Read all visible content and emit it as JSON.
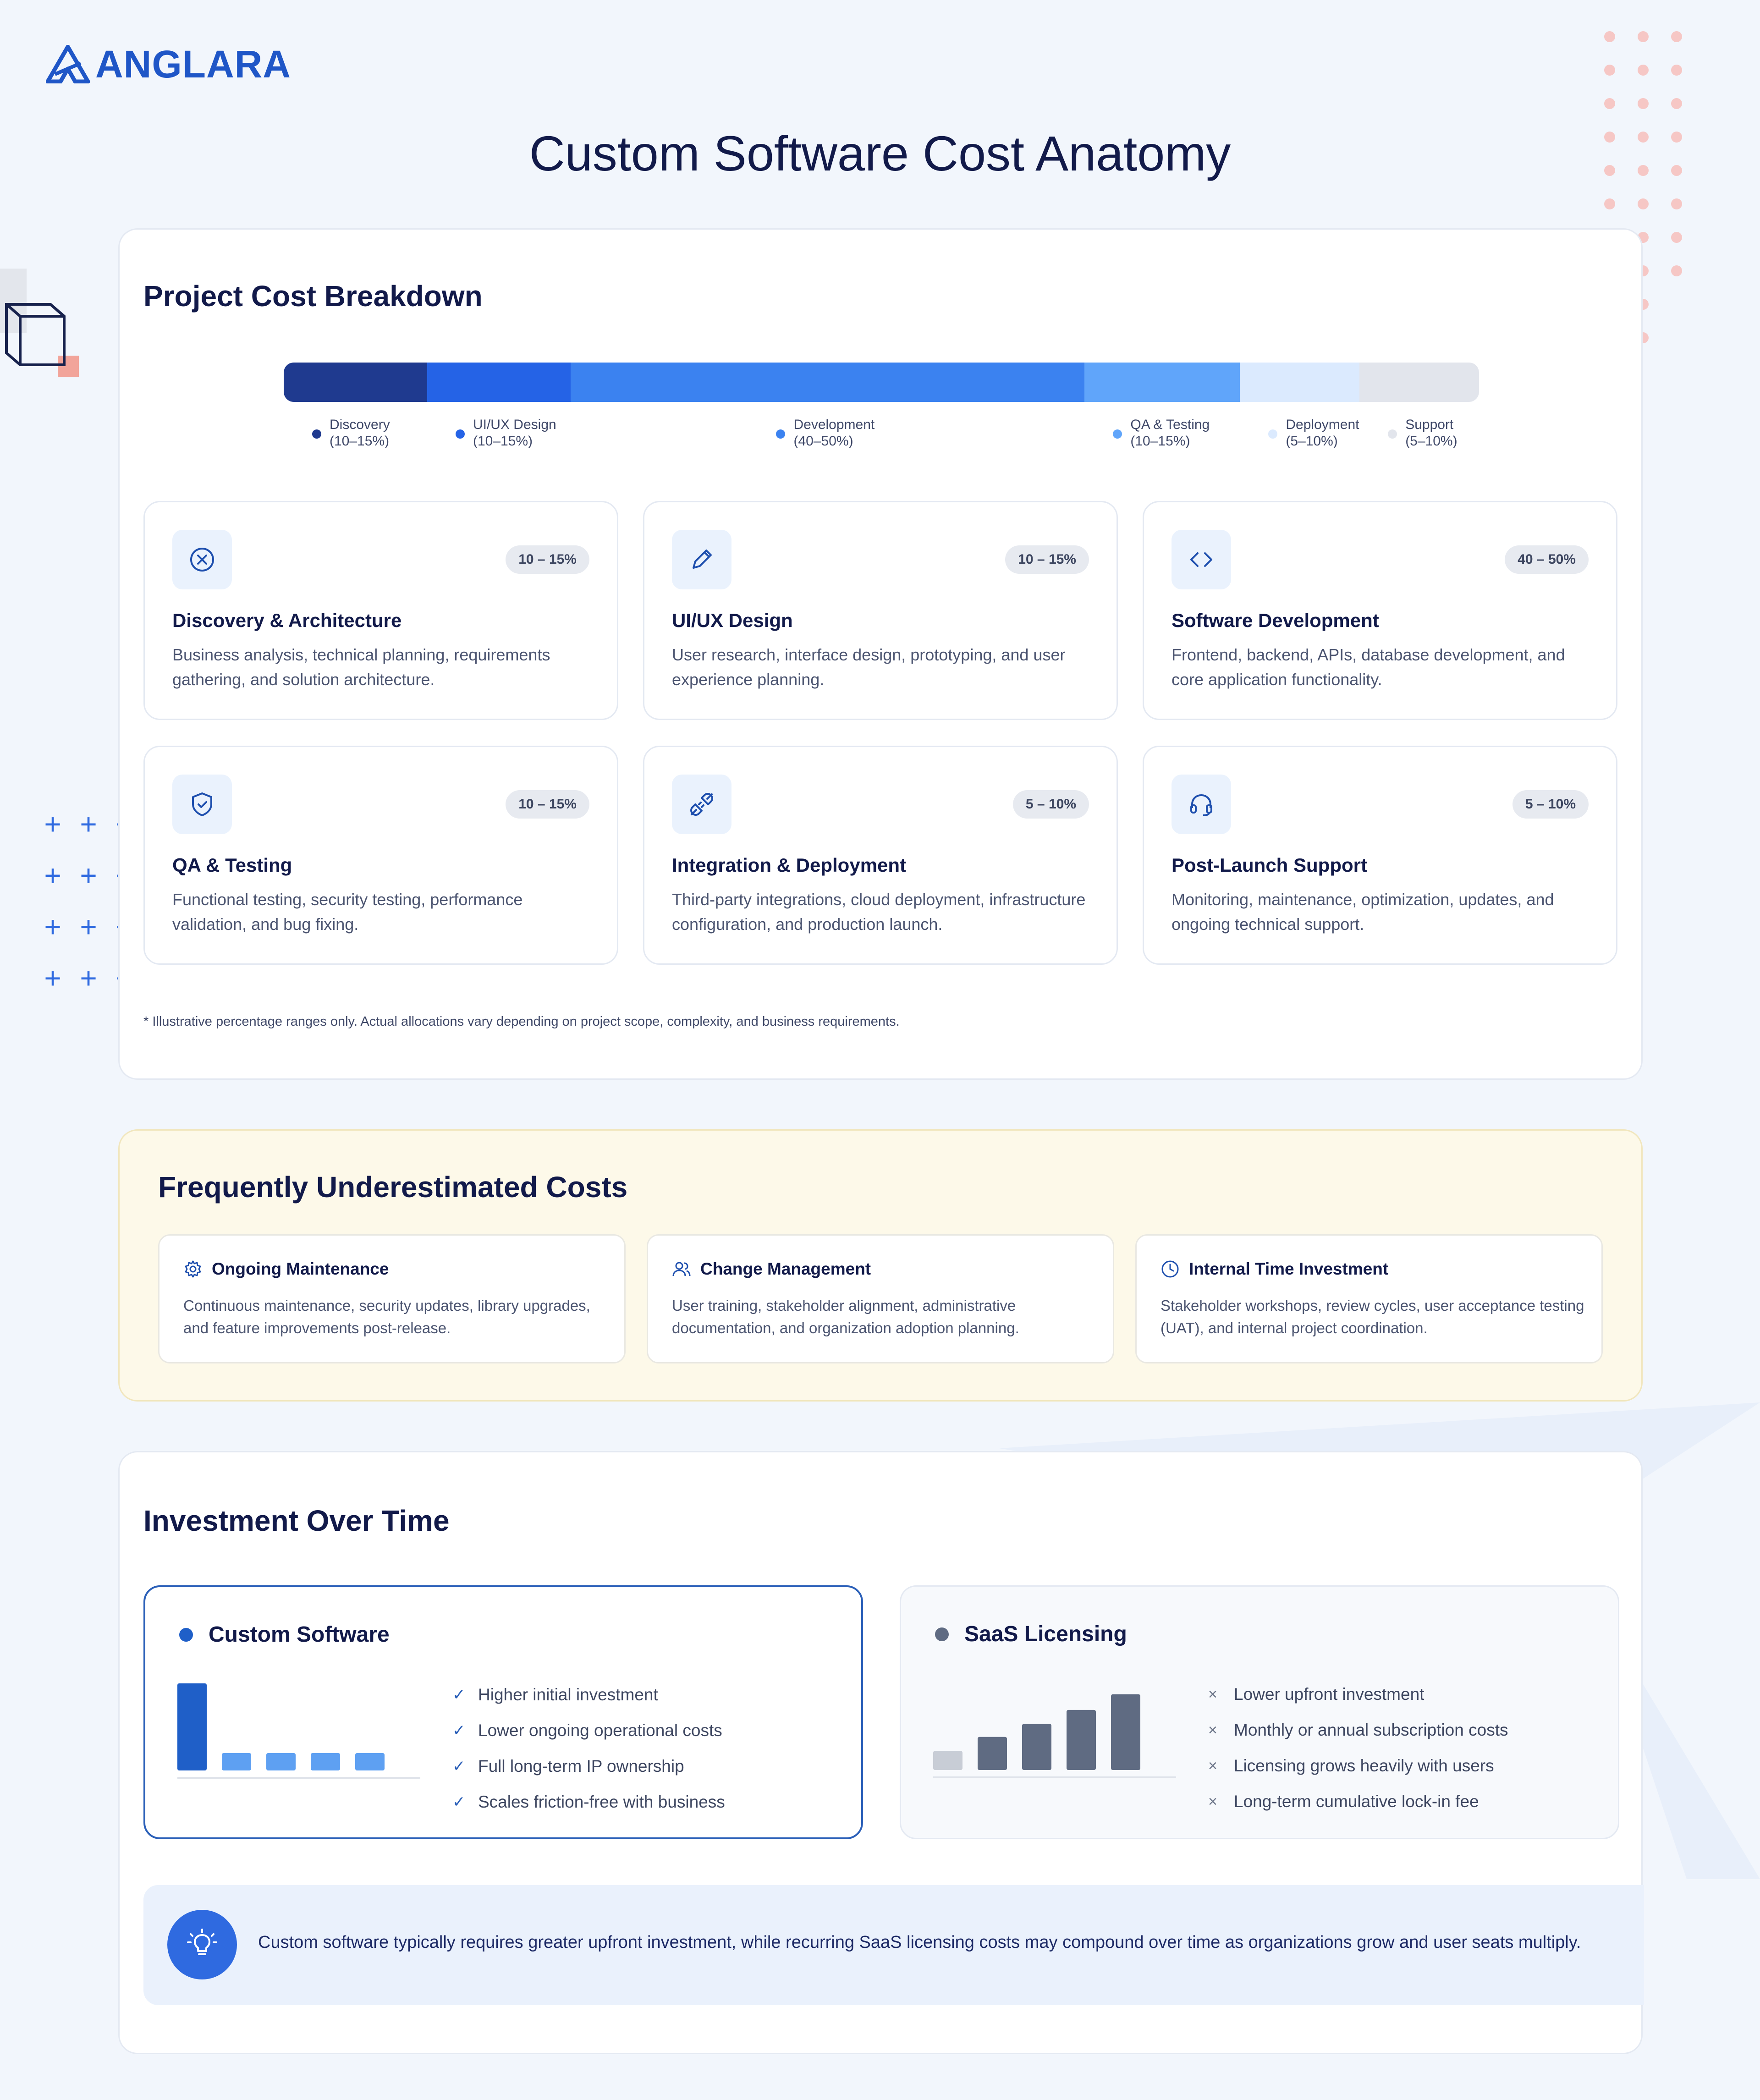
{
  "brand": {
    "name": "ANGLARA"
  },
  "page": {
    "title": "Custom Software Cost Anatomy"
  },
  "breakdown": {
    "title": "Project Cost Breakdown",
    "segments": [
      {
        "label": "Discovery",
        "range": "(10–15%)",
        "share": 12,
        "color": "#1f3a8f"
      },
      {
        "label": "UI/UX Design",
        "range": "(10–15%)",
        "share": 12,
        "color": "#2563e6"
      },
      {
        "label": "Development",
        "range": "(40–50%)",
        "share": 43,
        "color": "#3b82f0"
      },
      {
        "label": "QA & Testing",
        "range": "(10–15%)",
        "share": 13,
        "color": "#60a5fa"
      },
      {
        "label": "Deployment",
        "range": "(5–10%)",
        "share": 10,
        "color": "#dbeafe"
      },
      {
        "label": "Support",
        "range": "(5–10%)",
        "share": 10,
        "color": "#e2e5ec"
      }
    ],
    "phases": [
      {
        "icon": "close-circle-icon",
        "badge": "10 – 15%",
        "title": "Discovery & Architecture",
        "desc": "Business analysis, technical planning, requirements gathering, and solution architecture."
      },
      {
        "icon": "pencil-icon",
        "badge": "10 – 15%",
        "title": "UI/UX Design",
        "desc": "User research, interface design, prototyping, and user experience planning."
      },
      {
        "icon": "code-icon",
        "badge": "40 – 50%",
        "title": "Software Development",
        "desc": "Frontend, backend, APIs, database development, and core application functionality."
      },
      {
        "icon": "shield-check-icon",
        "badge": "10 – 15%",
        "title": "QA & Testing",
        "desc": "Functional testing, security testing, performance validation, and bug fixing."
      },
      {
        "icon": "plug-icon",
        "badge": "5 – 10%",
        "title": "Integration & Deployment",
        "desc": "Third-party integrations, cloud deployment, infrastructure configuration, and production launch."
      },
      {
        "icon": "headset-icon",
        "badge": "5 – 10%",
        "title": "Post-Launch Support",
        "desc": "Monitoring, maintenance, optimization, updates, and ongoing technical support."
      }
    ],
    "footnote": "* Illustrative percentage ranges only. Actual allocations vary depending on project scope, complexity, and business requirements."
  },
  "underestimated": {
    "title": "Frequently Underestimated Costs",
    "items": [
      {
        "icon": "gear-icon",
        "title": "Ongoing Maintenance",
        "desc": "Continuous maintenance, security updates, library upgrades, and feature improvements post-release."
      },
      {
        "icon": "users-icon",
        "title": "Change Management",
        "desc": "User training, stakeholder alignment, administrative documentation, and organization adoption planning."
      },
      {
        "icon": "clock-icon",
        "title": "Internal Time Investment",
        "desc": "Stakeholder workshops, review cycles, user acceptance testing (UAT), and internal project coordination."
      }
    ]
  },
  "investment": {
    "title": "Investment Over Time",
    "custom": {
      "title": "Custom Software",
      "dot_color": "#1f5fc8",
      "bars": [
        1.0,
        0.2,
        0.2,
        0.2,
        0.2
      ],
      "bar_colors": [
        "#1f5fc8",
        "#5ea0f2",
        "#5ea0f2",
        "#5ea0f2",
        "#5ea0f2"
      ],
      "points": [
        "Higher initial investment",
        "Lower ongoing operational costs",
        "Full long-term IP ownership",
        "Scales friction-free with business"
      ]
    },
    "saas": {
      "title": "SaaS Licensing",
      "dot_color": "#5f6b82",
      "bars": [
        0.22,
        0.38,
        0.53,
        0.69,
        0.87
      ],
      "bar_colors": [
        "#c8cdd6",
        "#5f6b82",
        "#5f6b82",
        "#5f6b82",
        "#5f6b82"
      ],
      "points": [
        "Lower upfront investment",
        "Monthly or annual subscription costs",
        "Licensing grows heavily with users",
        "Long-term cumulative lock-in fee"
      ]
    },
    "insight": "Custom software typically requires greater upfront investment, while recurring SaaS licensing costs may compound over time as organizations grow and user seats multiply."
  }
}
